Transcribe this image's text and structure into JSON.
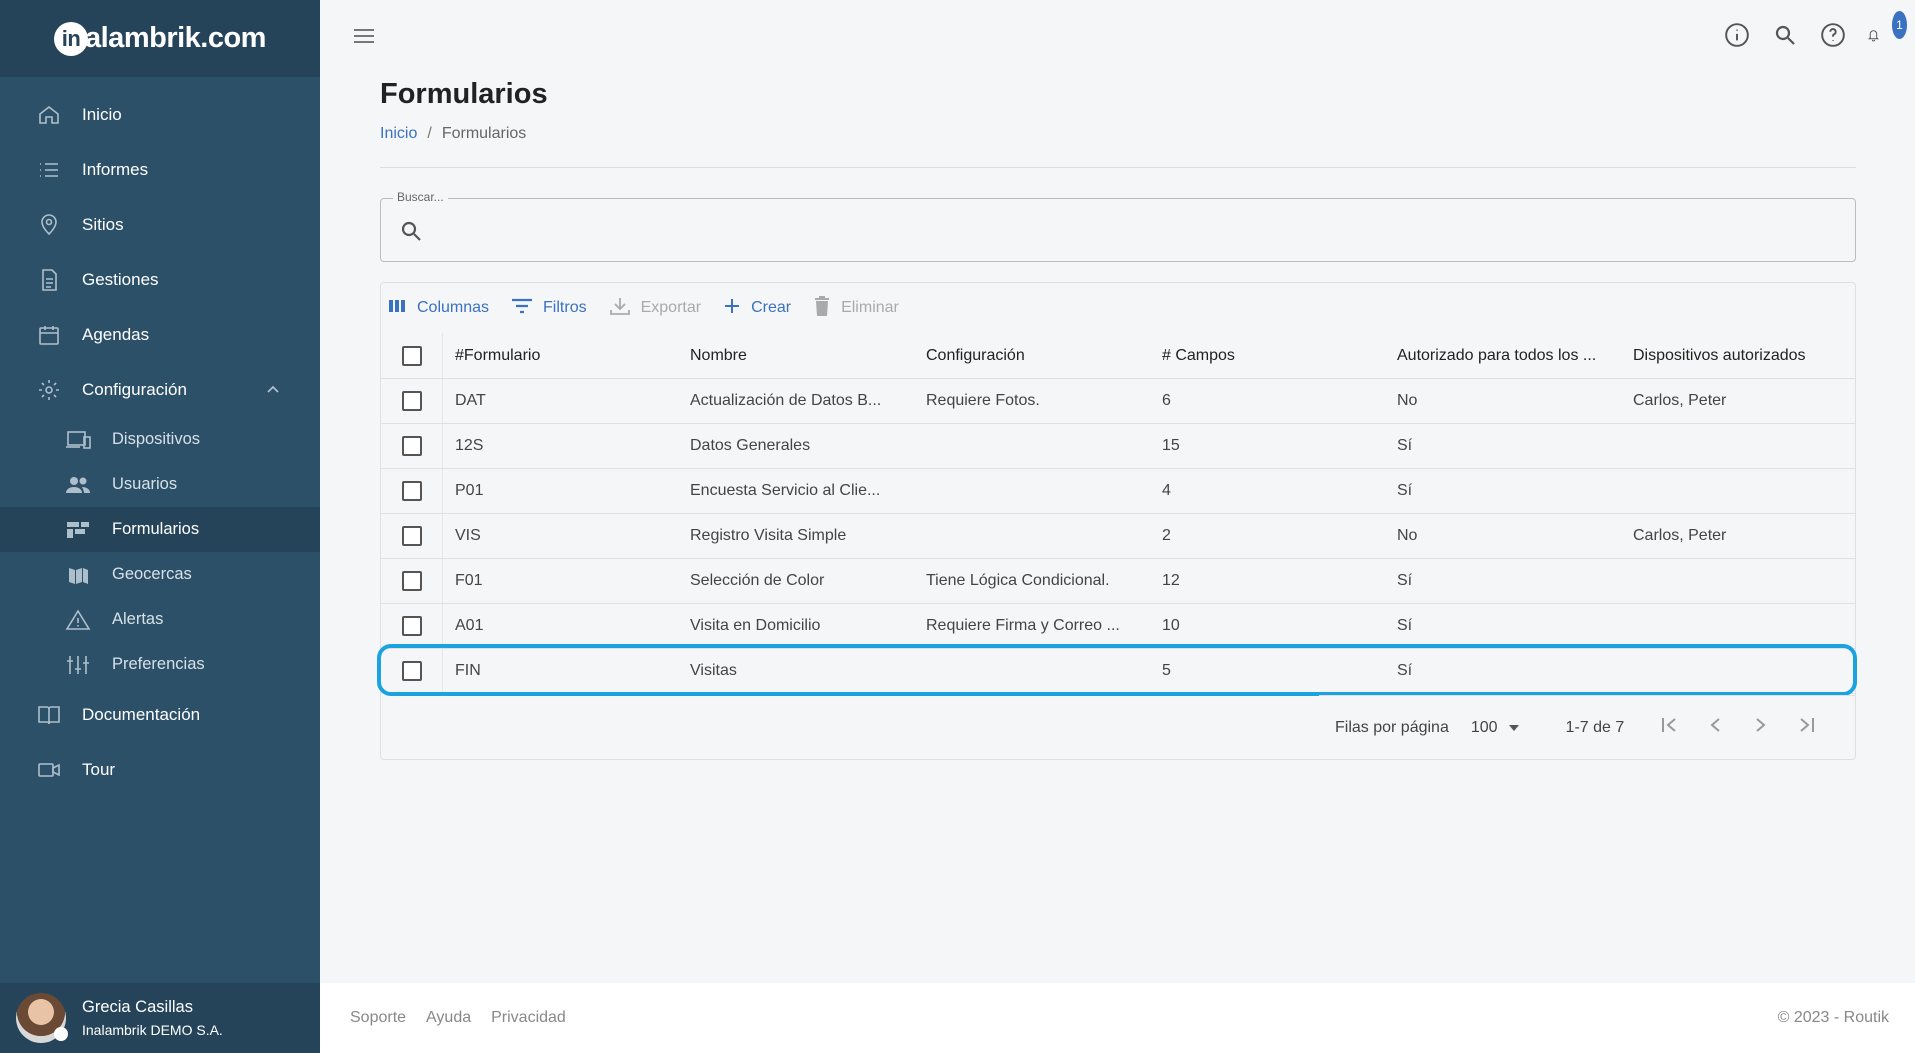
{
  "brand": {
    "logo_mark": "in",
    "logo_text": "alambrik.com"
  },
  "sidebar": {
    "items": [
      {
        "label": "Inicio",
        "icon": "home-icon"
      },
      {
        "label": "Informes",
        "icon": "list-icon"
      },
      {
        "label": "Sitios",
        "icon": "location-pin-icon"
      },
      {
        "label": "Gestiones",
        "icon": "document-icon"
      },
      {
        "label": "Agendas",
        "icon": "calendar-icon"
      },
      {
        "label": "Configuración",
        "icon": "gear-icon",
        "expanded": true
      }
    ],
    "subitems": [
      {
        "label": "Dispositivos",
        "icon": "devices-icon"
      },
      {
        "label": "Usuarios",
        "icon": "users-icon"
      },
      {
        "label": "Formularios",
        "icon": "forms-icon",
        "active": true
      },
      {
        "label": "Geocercas",
        "icon": "map-icon"
      },
      {
        "label": "Alertas",
        "icon": "warning-icon"
      },
      {
        "label": "Preferencias",
        "icon": "sliders-icon"
      }
    ],
    "bottom_items": [
      {
        "label": "Documentación",
        "icon": "book-icon"
      },
      {
        "label": "Tour",
        "icon": "video-icon"
      }
    ]
  },
  "user": {
    "name": "Grecia Casillas",
    "org": "Inalambrik DEMO S.A."
  },
  "header": {
    "notification_count": "1"
  },
  "page": {
    "title": "Formularios",
    "breadcrumb": {
      "home": "Inicio",
      "sep": "/",
      "current": "Formularios"
    }
  },
  "search": {
    "legend": "Buscar...",
    "value": ""
  },
  "toolbar": {
    "columns": "Columnas",
    "filters": "Filtros",
    "export": "Exportar",
    "create": "Crear",
    "delete": "Eliminar"
  },
  "table": {
    "headers": [
      "#Formulario",
      "Nombre",
      "Configuración",
      "# Campos",
      "Autorizado para todos los ...",
      "Dispositivos autorizados"
    ],
    "rows": [
      [
        "DAT",
        "Actualización de Datos B...",
        "Requiere Fotos.",
        "6",
        "No",
        "Carlos, Peter"
      ],
      [
        "12S",
        "Datos Generales",
        "",
        "15",
        "Sí",
        ""
      ],
      [
        "P01",
        "Encuesta Servicio al Clie...",
        "",
        "4",
        "Sí",
        ""
      ],
      [
        "VIS",
        "Registro Visita Simple",
        "",
        "2",
        "No",
        "Carlos, Peter"
      ],
      [
        "F01",
        "Selección de Color",
        "Tiene Lógica Condicional.",
        "12",
        "Sí",
        ""
      ],
      [
        "A01",
        "Visita en Domicilio",
        "Requiere Firma y Correo ...",
        "10",
        "Sí",
        ""
      ],
      [
        "FIN",
        "Visitas",
        "",
        "5",
        "Sí",
        ""
      ]
    ]
  },
  "pagination": {
    "rows_label": "Filas por página",
    "rows_value": "100",
    "range": "1-7 de 7"
  },
  "footer": {
    "links": [
      "Soporte",
      "Ayuda",
      "Privacidad"
    ],
    "copyright": "© 2023 - Routik"
  },
  "colors": {
    "sidebar": "#2c5068",
    "sidebar_dark": "#254459",
    "accent": "#3a71c1",
    "highlight": "#1aa3e0"
  }
}
